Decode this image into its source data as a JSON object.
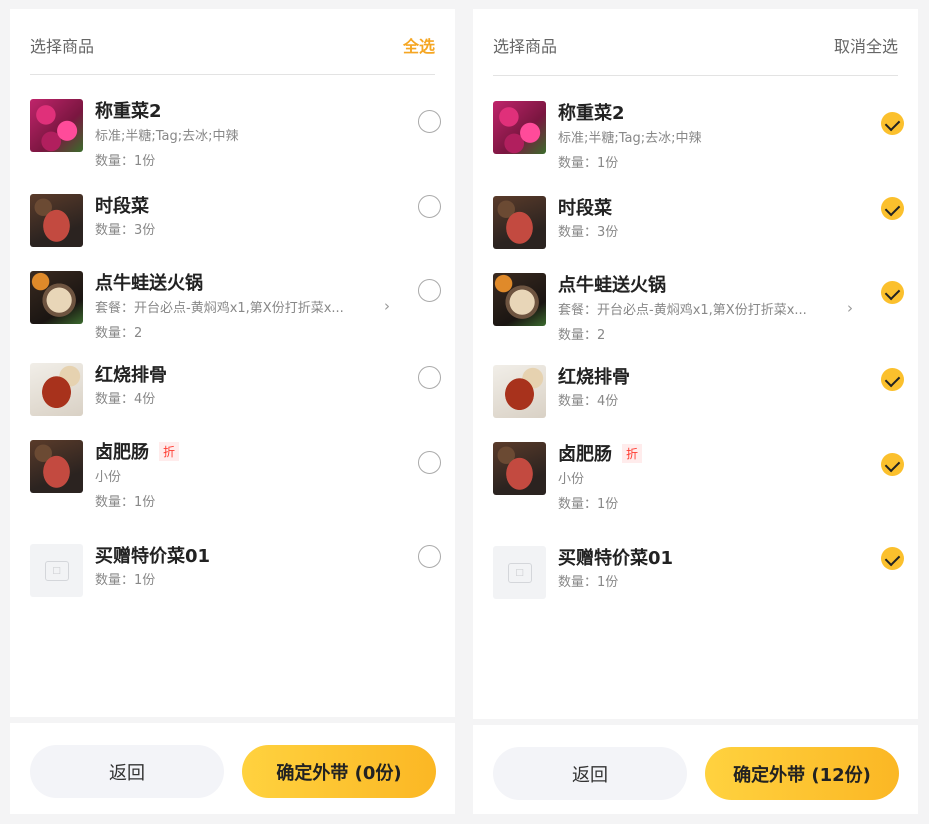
{
  "panels": [
    {
      "header": {
        "title": "选择商品",
        "action": "全选"
      },
      "items": [
        {
          "name": "称重菜2",
          "detail": "标准;半糖;Tag;去冰;中辣",
          "qty": "数量：1份",
          "tag": "",
          "checked": false,
          "image": "flowers"
        },
        {
          "name": "时段菜",
          "detail": "",
          "qty": "数量：3份",
          "tag": "",
          "checked": false,
          "image": "steak"
        },
        {
          "name": "点牛蛙送火锅",
          "detail": "套餐：开台必点-黄焖鸡x1,第X份打折菜x...",
          "qty": "数量：2",
          "tag": "",
          "checked": false,
          "image": "hotpot"
        },
        {
          "name": "红烧排骨",
          "detail": "",
          "qty": "数量：4份",
          "tag": "",
          "checked": false,
          "image": "ribs"
        },
        {
          "name": "卤肥肠",
          "detail": "小份",
          "qty": "数量：1份",
          "tag": "折",
          "checked": false,
          "image": "steak"
        },
        {
          "name": "买赠特价菜01",
          "detail": "",
          "qty": "数量：1份",
          "tag": "",
          "checked": false,
          "image": "placeholder"
        }
      ],
      "footer": {
        "back": "返回",
        "confirm": "确定外带 (0份)"
      }
    },
    {
      "header": {
        "title": "选择商品",
        "action": "取消全选"
      },
      "items": [
        {
          "name": "称重菜2",
          "detail": "标准;半糖;Tag;去冰;中辣",
          "qty": "数量：1份",
          "tag": "",
          "checked": true,
          "image": "flowers"
        },
        {
          "name": "时段菜",
          "detail": "",
          "qty": "数量：3份",
          "tag": "",
          "checked": true,
          "image": "steak"
        },
        {
          "name": "点牛蛙送火锅",
          "detail": "套餐：开台必点-黄焖鸡x1,第X份打折菜x...",
          "qty": "数量：2",
          "tag": "",
          "checked": true,
          "image": "hotpot"
        },
        {
          "name": "红烧排骨",
          "detail": "",
          "qty": "数量：4份",
          "tag": "",
          "checked": true,
          "image": "ribs"
        },
        {
          "name": "卤肥肠",
          "detail": "小份",
          "qty": "数量：1份",
          "tag": "折",
          "checked": true,
          "image": "steak"
        },
        {
          "name": "买赠特价菜01",
          "detail": "",
          "qty": "数量：1份",
          "tag": "",
          "checked": true,
          "image": "placeholder"
        }
      ],
      "footer": {
        "back": "返回",
        "confirm": "确定外带 (12份)"
      }
    }
  ],
  "colors": {
    "accent": "#f5a623",
    "check": "#fbc02d",
    "confirm_from": "#ffd23f",
    "confirm_to": "#fbb724",
    "tag": "#ff3b30"
  }
}
